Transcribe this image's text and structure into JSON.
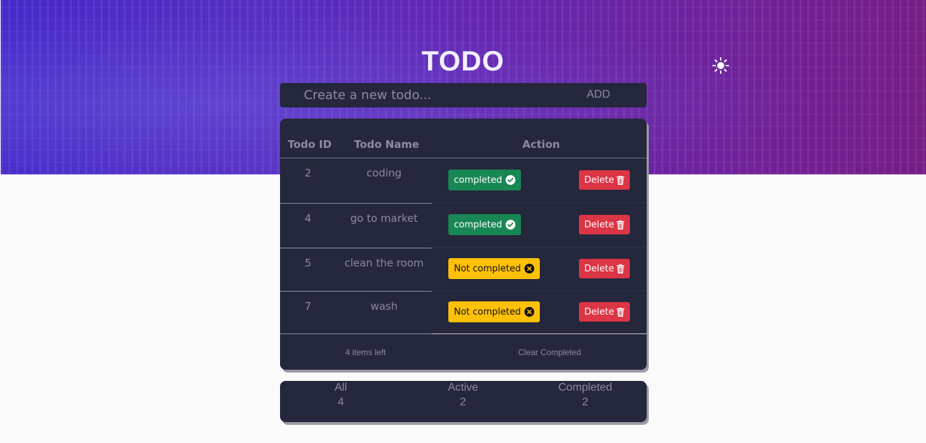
{
  "app": {
    "title": "TODO",
    "theme_toggle_icon": "sun-icon"
  },
  "add_bar": {
    "placeholder": "Create a new todo...",
    "add_label": "ADD"
  },
  "table": {
    "headers": {
      "id": "Todo ID",
      "name": "Todo Name",
      "action": "Action"
    },
    "rows": [
      {
        "id": "2",
        "name": "coding",
        "status": "completed",
        "status_icon": "check-circle-icon",
        "delete_label": "Delete"
      },
      {
        "id": "4",
        "name": "go to market",
        "status": "completed",
        "status_icon": "check-circle-icon",
        "delete_label": "Delete"
      },
      {
        "id": "5",
        "name": "clean the room",
        "status": "Not completed",
        "status_icon": "x-circle-icon",
        "delete_label": "Delete"
      },
      {
        "id": "7",
        "name": "wash",
        "status": "Not completed",
        "status_icon": "x-circle-icon",
        "delete_label": "Delete"
      }
    ],
    "footer": {
      "items_left": "4 items left",
      "clear_completed": "Clear Completed"
    }
  },
  "filters": [
    {
      "label": "All",
      "count": "4"
    },
    {
      "label": "Active",
      "count": "2"
    },
    {
      "label": "Completed",
      "count": "2"
    }
  ],
  "colors": {
    "card_bg": "#25273c",
    "completed_green": "#198754",
    "not_completed_yellow": "#ffc107",
    "delete_red": "#dc3545",
    "hero_start": "#4a2bd0",
    "hero_end": "#7a1f8a"
  }
}
